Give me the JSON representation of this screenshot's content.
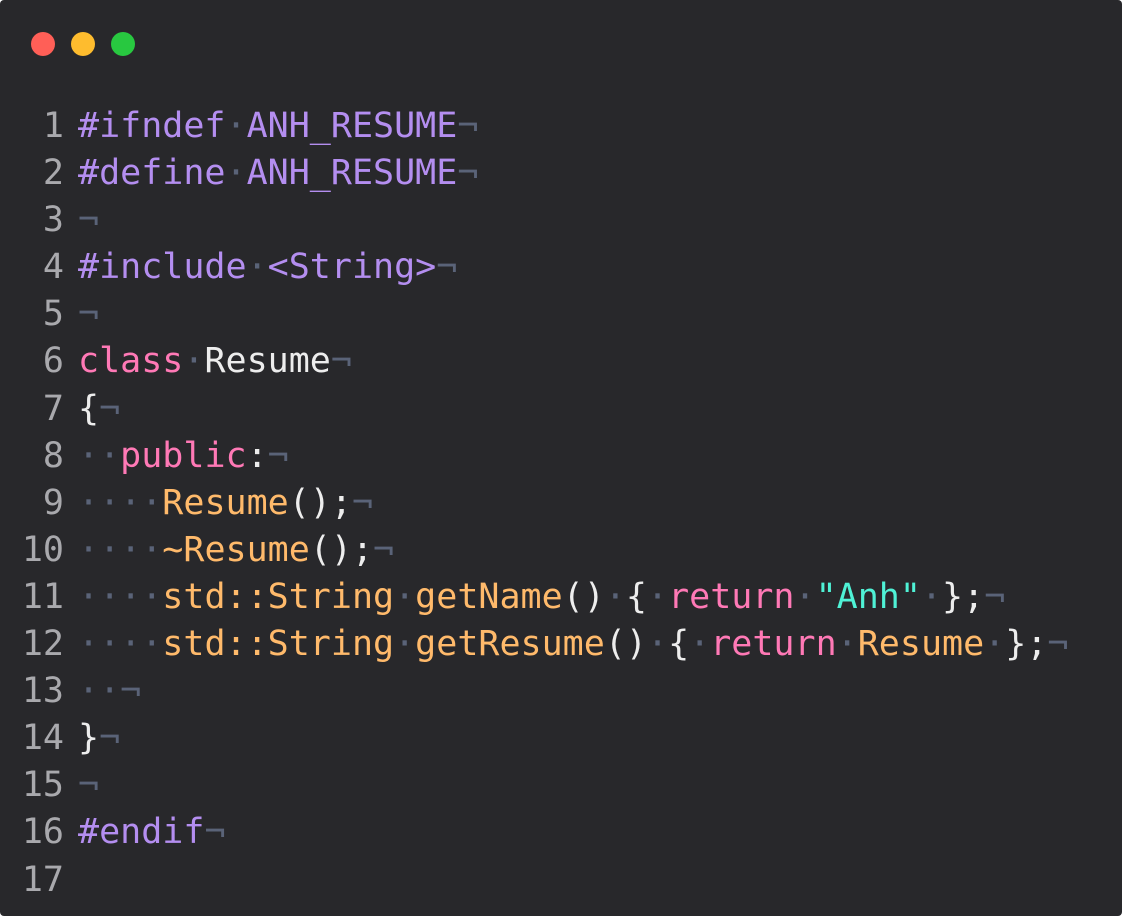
{
  "window": {
    "controls": [
      {
        "name": "close",
        "color": "#ff5f57"
      },
      {
        "name": "minimize",
        "color": "#febc2e"
      },
      {
        "name": "maximize",
        "color": "#28c840"
      }
    ]
  },
  "colors": {
    "background": "#28282b",
    "line_number": "#a9a9ad",
    "preprocessor": "#b48ef0",
    "keyword": "#ff79b6",
    "function": "#ffba6b",
    "string": "#4ff2d6",
    "plain": "#ededed",
    "whitespace": "#5a6378"
  },
  "editor": {
    "lines": [
      {
        "number": "1",
        "tokens": [
          {
            "text": "#ifndef",
            "t": "preprocessor"
          },
          {
            "text": "·",
            "t": "whitespace"
          },
          {
            "text": "ANH_RESUME",
            "t": "preprocessor"
          },
          {
            "text": "¬",
            "t": "whitespace"
          }
        ]
      },
      {
        "number": "2",
        "tokens": [
          {
            "text": "#define",
            "t": "preprocessor"
          },
          {
            "text": "·",
            "t": "whitespace"
          },
          {
            "text": "ANH_RESUME",
            "t": "preprocessor"
          },
          {
            "text": "¬",
            "t": "whitespace"
          }
        ]
      },
      {
        "number": "3",
        "tokens": [
          {
            "text": "¬",
            "t": "whitespace"
          }
        ]
      },
      {
        "number": "4",
        "tokens": [
          {
            "text": "#include",
            "t": "preprocessor"
          },
          {
            "text": "·",
            "t": "whitespace"
          },
          {
            "text": "<String>",
            "t": "preprocessor"
          },
          {
            "text": "¬",
            "t": "whitespace"
          }
        ]
      },
      {
        "number": "5",
        "tokens": [
          {
            "text": "¬",
            "t": "whitespace"
          }
        ]
      },
      {
        "number": "6",
        "tokens": [
          {
            "text": "class",
            "t": "keyword"
          },
          {
            "text": "·",
            "t": "whitespace"
          },
          {
            "text": "Resume",
            "t": "plain"
          },
          {
            "text": "¬",
            "t": "whitespace"
          }
        ]
      },
      {
        "number": "7",
        "tokens": [
          {
            "text": "{",
            "t": "plain"
          },
          {
            "text": "¬",
            "t": "whitespace"
          }
        ]
      },
      {
        "number": "8",
        "tokens": [
          {
            "text": "··",
            "t": "whitespace"
          },
          {
            "text": "public",
            "t": "keyword"
          },
          {
            "text": ":",
            "t": "plain"
          },
          {
            "text": "¬",
            "t": "whitespace"
          }
        ]
      },
      {
        "number": "9",
        "tokens": [
          {
            "text": "····",
            "t": "whitespace"
          },
          {
            "text": "Resume",
            "t": "function"
          },
          {
            "text": "();",
            "t": "plain"
          },
          {
            "text": "¬",
            "t": "whitespace"
          }
        ]
      },
      {
        "number": "10",
        "tokens": [
          {
            "text": "····",
            "t": "whitespace"
          },
          {
            "text": "~Resume",
            "t": "function"
          },
          {
            "text": "();",
            "t": "plain"
          },
          {
            "text": "¬",
            "t": "whitespace"
          }
        ]
      },
      {
        "number": "11",
        "tokens": [
          {
            "text": "····",
            "t": "whitespace"
          },
          {
            "text": "std::String",
            "t": "function"
          },
          {
            "text": "·",
            "t": "whitespace"
          },
          {
            "text": "getName",
            "t": "function"
          },
          {
            "text": "()",
            "t": "plain"
          },
          {
            "text": "·",
            "t": "whitespace"
          },
          {
            "text": "{",
            "t": "plain"
          },
          {
            "text": "·",
            "t": "whitespace"
          },
          {
            "text": "return",
            "t": "keyword"
          },
          {
            "text": "·",
            "t": "whitespace"
          },
          {
            "text": "\"Anh\"",
            "t": "string"
          },
          {
            "text": "·",
            "t": "whitespace"
          },
          {
            "text": "};",
            "t": "plain"
          },
          {
            "text": "¬",
            "t": "whitespace"
          }
        ]
      },
      {
        "number": "12",
        "tokens": [
          {
            "text": "····",
            "t": "whitespace"
          },
          {
            "text": "std::String",
            "t": "function"
          },
          {
            "text": "·",
            "t": "whitespace"
          },
          {
            "text": "getResume",
            "t": "function"
          },
          {
            "text": "()",
            "t": "plain"
          },
          {
            "text": "·",
            "t": "whitespace"
          },
          {
            "text": "{",
            "t": "plain"
          },
          {
            "text": "·",
            "t": "whitespace"
          },
          {
            "text": "return",
            "t": "keyword"
          },
          {
            "text": "·",
            "t": "whitespace"
          },
          {
            "text": "Resume",
            "t": "function"
          },
          {
            "text": "·",
            "t": "whitespace"
          },
          {
            "text": "};",
            "t": "plain"
          },
          {
            "text": "¬",
            "t": "whitespace"
          }
        ]
      },
      {
        "number": "13",
        "tokens": [
          {
            "text": "··",
            "t": "whitespace"
          },
          {
            "text": "¬",
            "t": "whitespace"
          }
        ]
      },
      {
        "number": "14",
        "tokens": [
          {
            "text": "}",
            "t": "plain"
          },
          {
            "text": "¬",
            "t": "whitespace"
          }
        ]
      },
      {
        "number": "15",
        "tokens": [
          {
            "text": "¬",
            "t": "whitespace"
          }
        ]
      },
      {
        "number": "16",
        "tokens": [
          {
            "text": "#endif",
            "t": "preprocessor"
          },
          {
            "text": "¬",
            "t": "whitespace"
          }
        ]
      },
      {
        "number": "17",
        "tokens": []
      }
    ]
  }
}
